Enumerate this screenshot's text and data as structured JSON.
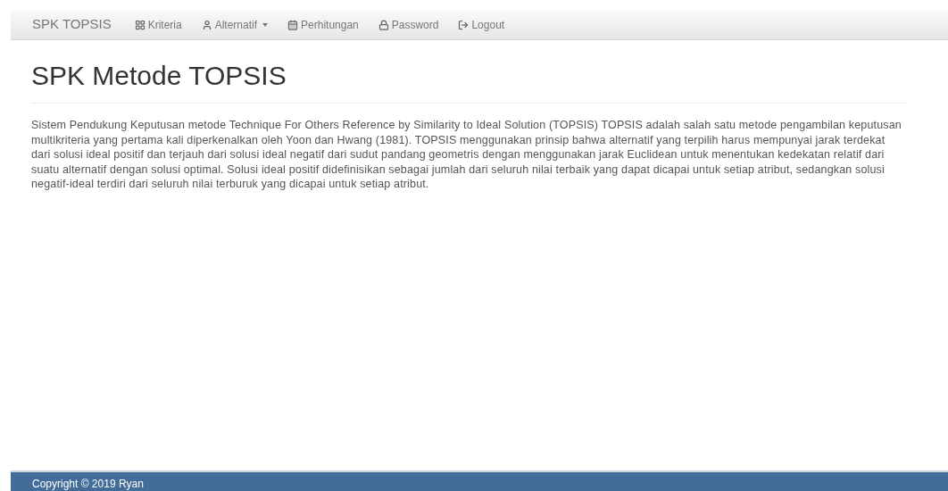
{
  "navbar": {
    "brand": "SPK TOPSIS",
    "items": [
      {
        "label": "Kriteria",
        "kind": "link"
      },
      {
        "label": "Alternatif",
        "kind": "dropdown"
      },
      {
        "label": "Perhitungan",
        "kind": "link"
      },
      {
        "label": "Password",
        "kind": "link"
      },
      {
        "label": "Logout",
        "kind": "link"
      }
    ]
  },
  "page": {
    "title": "SPK Metode TOPSIS",
    "description": "Sistem Pendukung Keputusan metode Technique For Others Reference by Similarity to Ideal Solution (TOPSIS) TOPSIS adalah salah satu metode pengambilan keputusan multikriteria yang pertama kali diperkenalkan oleh Yoon dan Hwang (1981). TOPSIS menggunakan prinsip bahwa alternatif yang terpilih harus mempunyai jarak terdekat dari solusi ideal positif dan terjauh dari solusi ideal negatif dari sudut pandang geometris dengan menggunakan jarak Euclidean untuk menentukan kedekatan relatif dari suatu alternatif dengan solusi optimal. Solusi ideal positif didefinisikan sebagai jumlah dari seluruh nilai terbaik yang dapat dicapai untuk setiap atribut, sedangkan solusi negatif-ideal terdiri dari seluruh nilai terburuk yang dicapai untuk setiap atribut."
  },
  "footer": {
    "text": "Copyright © 2019 Ryan"
  }
}
